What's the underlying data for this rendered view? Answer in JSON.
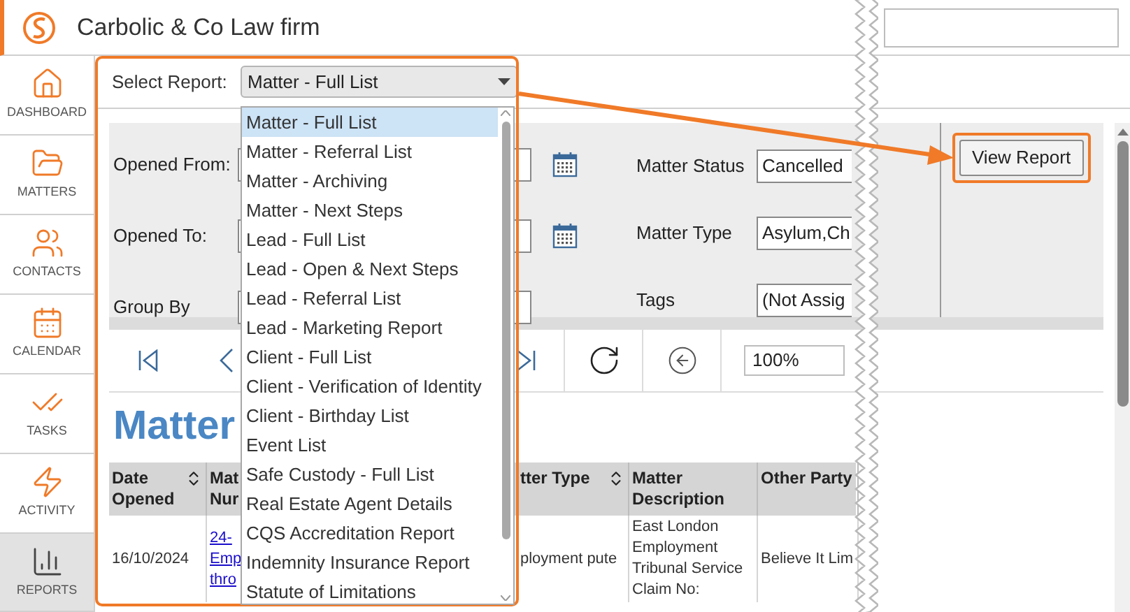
{
  "app": {
    "title": "Carbolic & Co Law firm"
  },
  "sidebar": {
    "items": [
      {
        "label": "DASHBOARD",
        "kind": "home",
        "selected": false
      },
      {
        "label": "MATTERS",
        "kind": "folder",
        "selected": false
      },
      {
        "label": "CONTACTS",
        "kind": "people",
        "selected": false
      },
      {
        "label": "CALENDAR",
        "kind": "calendar",
        "selected": false
      },
      {
        "label": "TASKS",
        "kind": "checks",
        "selected": false
      },
      {
        "label": "ACTIVITY",
        "kind": "bolt",
        "selected": false
      },
      {
        "label": "REPORTS",
        "kind": "chart",
        "selected": true
      }
    ]
  },
  "report_picker": {
    "label": "Select Report:",
    "value": "Matter - Full List",
    "options": [
      {
        "label": "Matter - Full List",
        "selected": true
      },
      {
        "label": "Matter - Referral List",
        "selected": false
      },
      {
        "label": "Matter - Archiving",
        "selected": false
      },
      {
        "label": "Matter - Next Steps",
        "selected": false
      },
      {
        "label": "Lead - Full List",
        "selected": false
      },
      {
        "label": "Lead - Open & Next Steps",
        "selected": false
      },
      {
        "label": "Lead - Referral List",
        "selected": false
      },
      {
        "label": "Lead - Marketing Report",
        "selected": false
      },
      {
        "label": "Client - Full List",
        "selected": false
      },
      {
        "label": "Client - Verification of Identity",
        "selected": false
      },
      {
        "label": "Client - Birthday List",
        "selected": false
      },
      {
        "label": "Event List",
        "selected": false
      },
      {
        "label": "Safe Custody - Full List",
        "selected": false
      },
      {
        "label": "Real Estate Agent Details",
        "selected": false
      },
      {
        "label": "CQS Accreditation Report",
        "selected": false
      },
      {
        "label": "Indemnity Insurance Report",
        "selected": false
      },
      {
        "label": "Statute of Limitations",
        "selected": false
      }
    ]
  },
  "filters": {
    "left_fields": [
      {
        "label": "Opened From:",
        "kind": "date"
      },
      {
        "label": "Opened To:",
        "kind": "date"
      },
      {
        "label": "Group By",
        "kind": "select"
      }
    ],
    "right_fields": [
      {
        "label": "Matter Status",
        "value": "Cancelled"
      },
      {
        "label": "Matter Type",
        "value": "Asylum,Ch"
      },
      {
        "label": "Tags",
        "value": "(Not Assig"
      }
    ],
    "button": "View Report"
  },
  "toolbar": {
    "zoom": "100%"
  },
  "report": {
    "title": "Matter",
    "table": {
      "columns": [
        {
          "label": "Date Opened",
          "sortable": true
        },
        {
          "label": "Mat Nur"
        },
        {
          "label": "tter Type",
          "sortable": true
        },
        {
          "label": "Matter Description",
          "sortable": false
        },
        {
          "label": "Other Party",
          "sortable": false
        }
      ],
      "rows": [
        {
          "cells": [
            "16/10/2024",
            "24- Emp thro",
            "ployment pute",
            "East London Employment Tribunal Service Claim No:",
            "Believe It Lim"
          ]
        }
      ]
    }
  }
}
